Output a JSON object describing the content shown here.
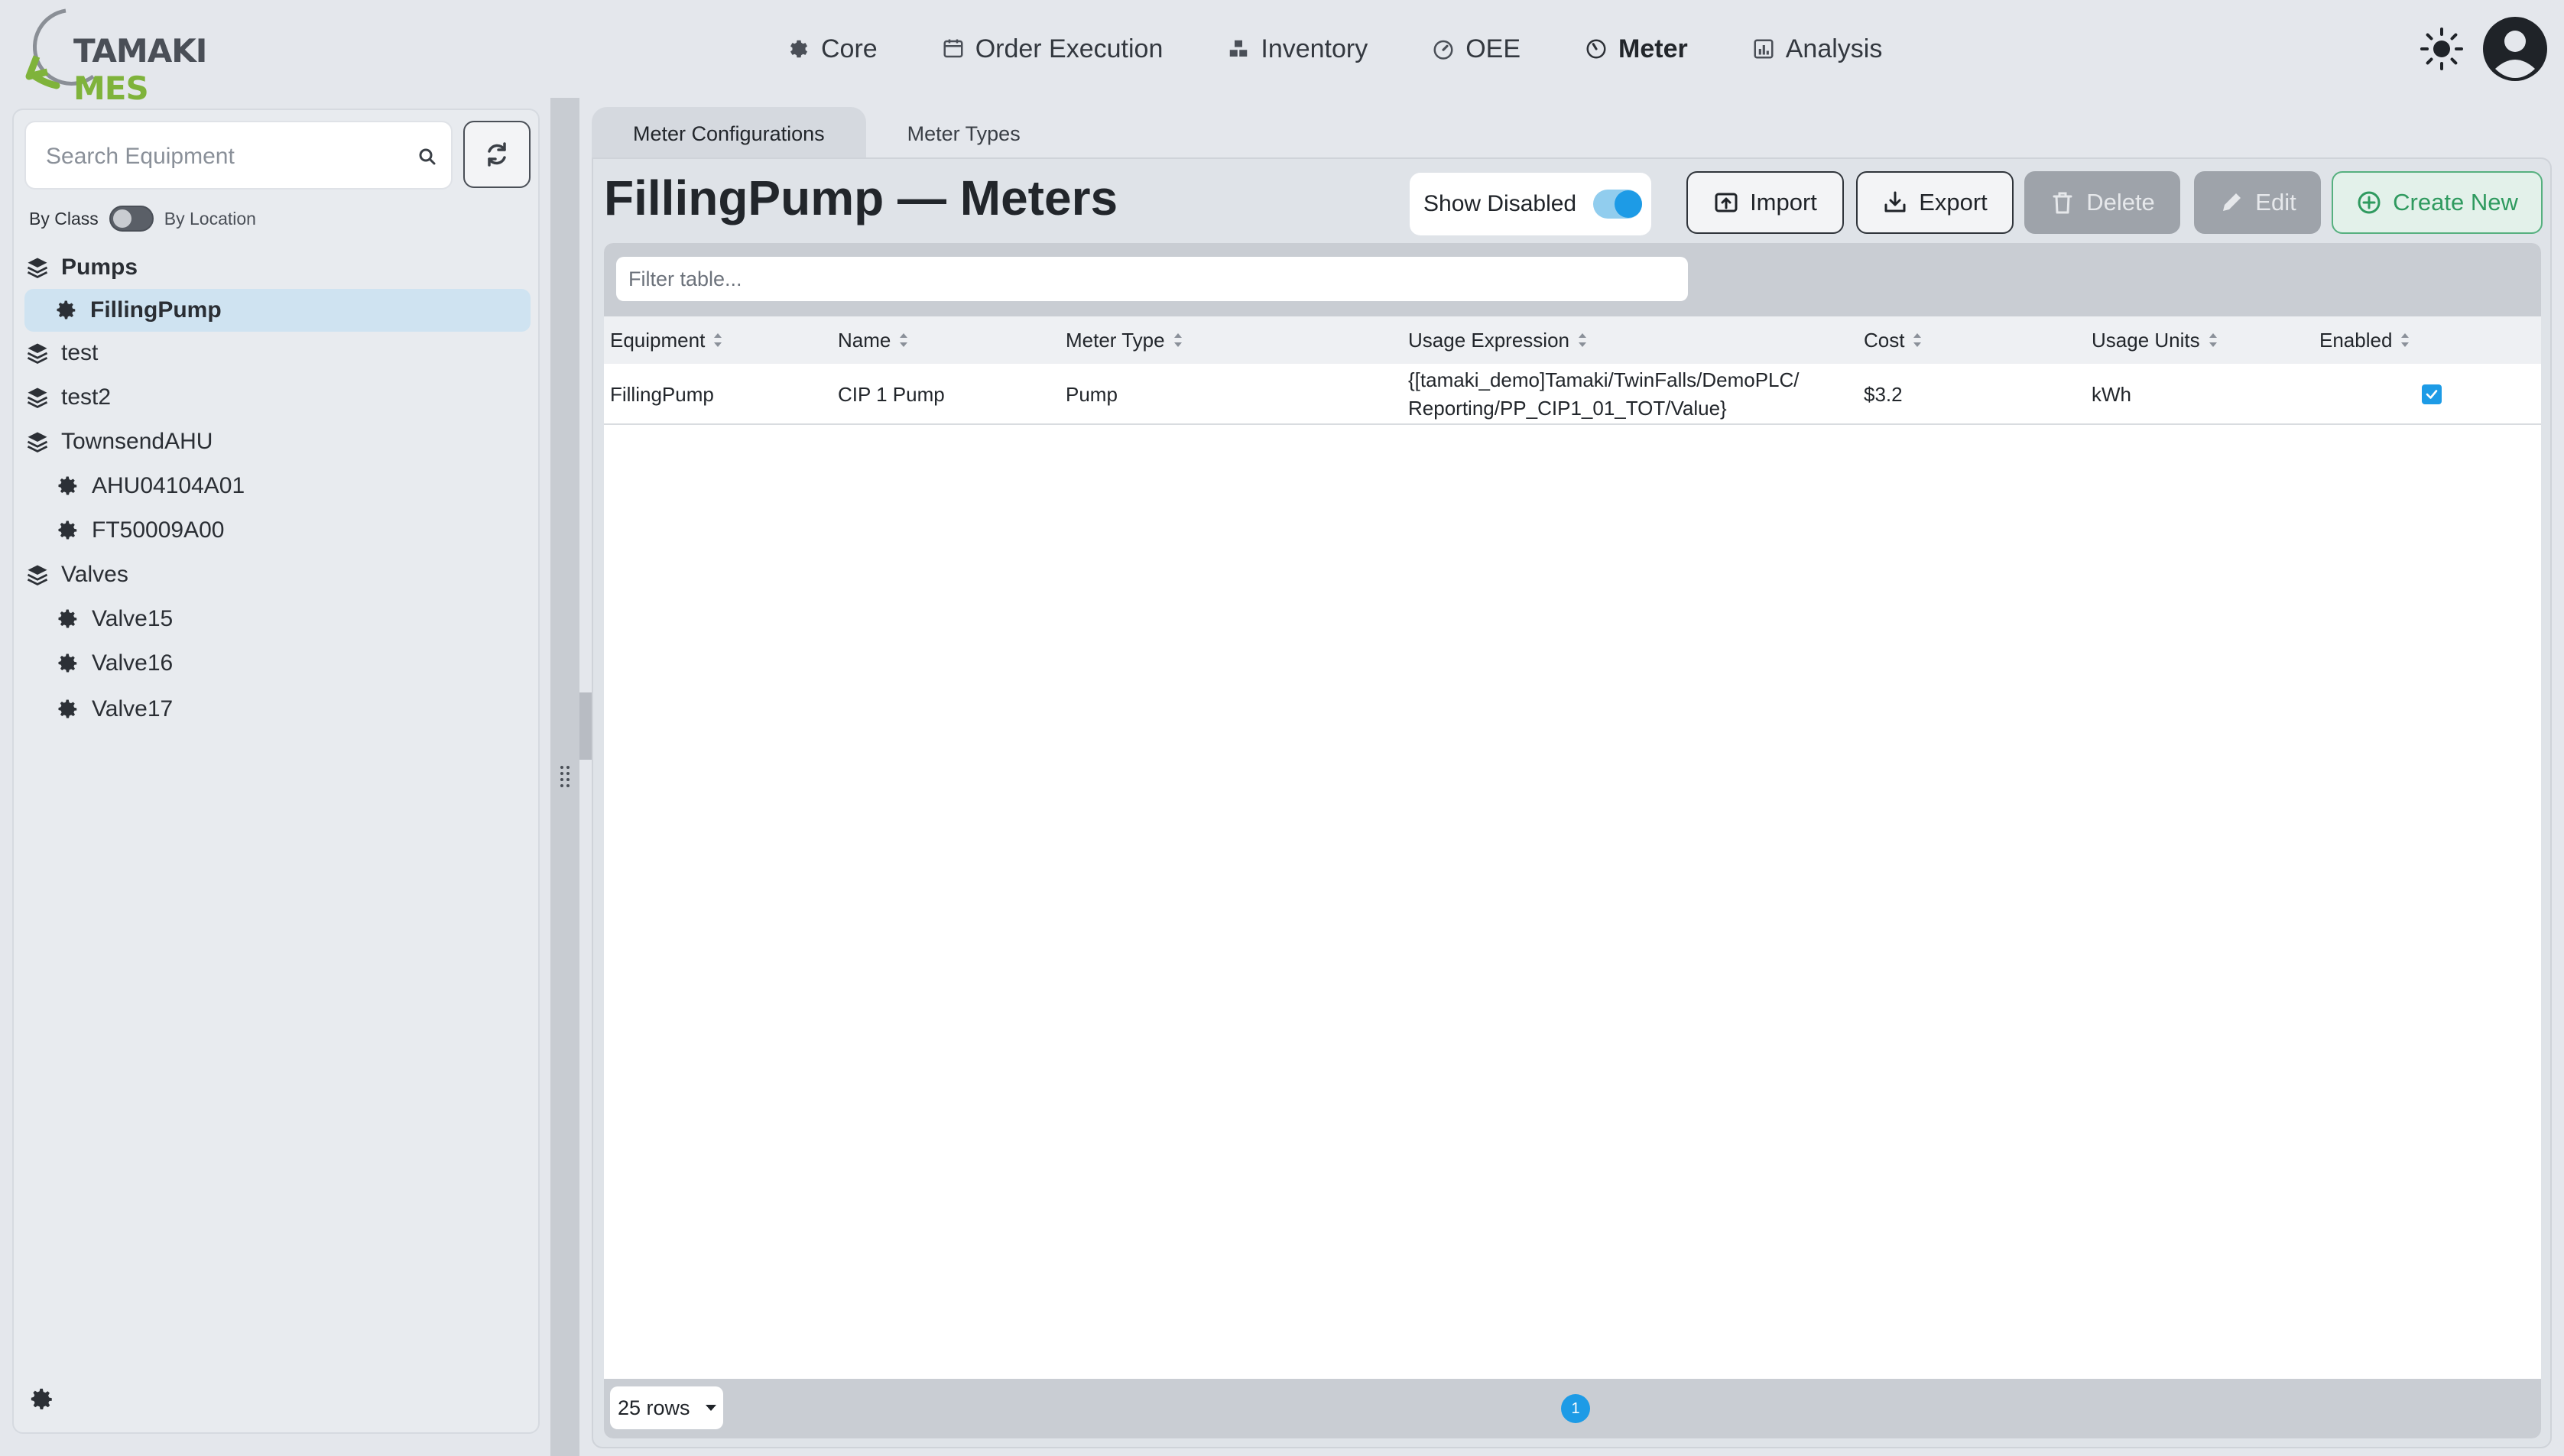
{
  "app": {
    "logo_part1": "TAMAKI",
    "logo_part2": "MES"
  },
  "nav": {
    "items": [
      {
        "label": "Core",
        "icon": "gear-icon"
      },
      {
        "label": "Order Execution",
        "icon": "calendar-icon"
      },
      {
        "label": "Inventory",
        "icon": "boxes-icon"
      },
      {
        "label": "OEE",
        "icon": "gauge-icon"
      },
      {
        "label": "Meter",
        "icon": "meter-icon",
        "active": true
      },
      {
        "label": "Analysis",
        "icon": "chart-icon"
      }
    ]
  },
  "sidebar": {
    "search_placeholder": "Search Equipment",
    "by_class": "By Class",
    "by_location": "By Location",
    "tree": [
      {
        "label": "Pumps",
        "type": "class",
        "icon": "layers-icon"
      },
      {
        "label": "FillingPump",
        "type": "equipment",
        "icon": "gear-icon",
        "selected": true
      },
      {
        "label": "test",
        "type": "class",
        "icon": "layers-icon"
      },
      {
        "label": "test2",
        "type": "class",
        "icon": "layers-icon"
      },
      {
        "label": "TownsendAHU",
        "type": "class",
        "icon": "layers-icon"
      },
      {
        "label": "AHU04104A01",
        "type": "equipment",
        "icon": "gear-icon"
      },
      {
        "label": "FT50009A00",
        "type": "equipment",
        "icon": "gear-icon"
      },
      {
        "label": "Valves",
        "type": "class",
        "icon": "layers-icon"
      },
      {
        "label": "Valve15",
        "type": "equipment",
        "icon": "gear-icon"
      },
      {
        "label": "Valve16",
        "type": "equipment",
        "icon": "gear-icon"
      },
      {
        "label": "Valve17",
        "type": "equipment",
        "icon": "gear-icon"
      }
    ]
  },
  "main": {
    "tabs": [
      {
        "label": "Meter Configurations",
        "active": true
      },
      {
        "label": "Meter Types"
      }
    ],
    "title": "FillingPump — Meters",
    "show_disabled_label": "Show Disabled",
    "show_disabled_on": true,
    "buttons": {
      "import": "Import",
      "export": "Export",
      "delete": "Delete",
      "edit": "Edit",
      "create": "Create New"
    },
    "filter_placeholder": "Filter table...",
    "columns": [
      "Equipment",
      "Name",
      "Meter Type",
      "Usage Expression",
      "Cost",
      "Usage Units",
      "Enabled"
    ],
    "rows": [
      {
        "equipment": "FillingPump",
        "name": "CIP 1 Pump",
        "meter_type": "Pump",
        "usage_expression_line1": "{[tamaki_demo]Tamaki/TwinFalls/DemoPLC/",
        "usage_expression_line2": "Reporting/PP_CIP1_01_TOT/Value}",
        "cost": "$3.2",
        "usage_units": "kWh",
        "enabled": true
      }
    ],
    "rows_per_page": "25 rows",
    "current_page": "1"
  },
  "colors": {
    "accent": "#1d9be6",
    "brand_green": "#7fb33b",
    "create_green": "#2f9a5f",
    "selected_bg": "#cfe3f1"
  }
}
